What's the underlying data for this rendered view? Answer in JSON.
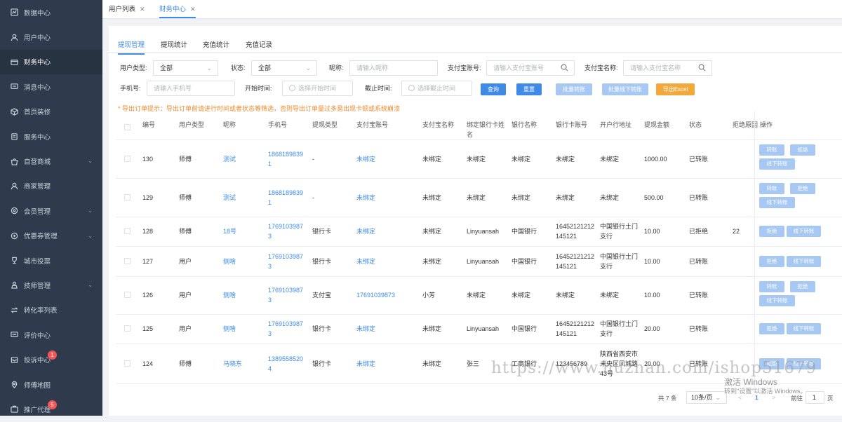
{
  "sidebar": {
    "items": [
      {
        "label": "数据中心",
        "icon": "chart-icon"
      },
      {
        "label": "用户中心",
        "icon": "user-icon"
      },
      {
        "label": "财务中心",
        "icon": "wallet-icon",
        "active": true
      },
      {
        "label": "消息中心",
        "icon": "message-icon"
      },
      {
        "label": "首页装修",
        "icon": "box-icon"
      },
      {
        "label": "服务中心",
        "icon": "clipboard-icon"
      },
      {
        "label": "自营商城",
        "icon": "shop-icon",
        "expandable": true
      },
      {
        "label": "商家管理",
        "icon": "merchant-icon"
      },
      {
        "label": "会员管理",
        "icon": "member-icon",
        "expandable": true
      },
      {
        "label": "优惠券管理",
        "icon": "coupon-icon",
        "expandable": true
      },
      {
        "label": "城市投票",
        "icon": "trophy-icon"
      },
      {
        "label": "技师管理",
        "icon": "technician-icon",
        "expandable": true
      },
      {
        "label": "转化率列表",
        "icon": "conversion-icon"
      },
      {
        "label": "评价中心",
        "icon": "comment-icon"
      },
      {
        "label": "投诉中心",
        "icon": "complaint-icon",
        "badge": "1"
      },
      {
        "label": "师傅地图",
        "icon": "map-pin-icon"
      },
      {
        "label": "推广代理",
        "icon": "promo-icon",
        "badge": "5"
      }
    ]
  },
  "page_tabs": [
    {
      "label": "用户列表",
      "active": false
    },
    {
      "label": "财务中心",
      "active": true
    }
  ],
  "inner_tabs": [
    "提现管理",
    "提现统计",
    "充值统计",
    "充值记录"
  ],
  "filters": {
    "user_type_label": "用户类型:",
    "user_type_value": "全部",
    "status_label": "状态:",
    "status_value": "全部",
    "nickname_label": "昵称:",
    "nickname_placeholder": "请输入昵称",
    "alipay_account_label": "支付宝账号:",
    "alipay_account_placeholder": "请输入支付宝账号",
    "alipay_name_label": "支付宝名称:",
    "alipay_name_placeholder": "请输入支付宝名称",
    "phone_label": "手机号:",
    "phone_placeholder": "请输入手机号",
    "start_label": "开始时间:",
    "start_placeholder": "选择开始时间",
    "end_label": "截止时间:",
    "end_placeholder": "选择截止时间"
  },
  "buttons": {
    "query": "查询",
    "reset": "重置",
    "batch_transfer": "批量转账",
    "batch_offline": "批量线下转账",
    "export": "导出Excel"
  },
  "notice": "* 导出订单提示：导出订单前请进行时间或者状态等筛选，否则导出订单量过多易出现卡顿或系统崩溃",
  "table": {
    "headers": [
      "编号",
      "用户类型",
      "昵称",
      "手机号",
      "提现类型",
      "支付宝账号",
      "支付宝名称",
      "绑定银行卡姓名",
      "银行名称",
      "银行卡账号",
      "开户行地址",
      "提现金额",
      "状态",
      "拒绝原因",
      "操作"
    ],
    "rows": [
      {
        "id": "130",
        "user_type": "师傅",
        "nickname": "测试",
        "phone": "18681898391",
        "withdraw_type": "-",
        "alipay_account": "未绑定",
        "alipay_name": "未绑定",
        "bank_holder": "未绑定",
        "bank_name": "未绑定",
        "bank_card": "未绑定",
        "bank_address": "未绑定",
        "amount": "1000.00",
        "status": "已转账",
        "reason": "",
        "actions": [
          "转账",
          "拒绝",
          "线下转账"
        ]
      },
      {
        "id": "129",
        "user_type": "师傅",
        "nickname": "测试",
        "phone": "18681898391",
        "withdraw_type": "-",
        "alipay_account": "未绑定",
        "alipay_name": "未绑定",
        "bank_holder": "未绑定",
        "bank_name": "未绑定",
        "bank_card": "未绑定",
        "bank_address": "未绑定",
        "amount": "500.00",
        "status": "已转账",
        "reason": "",
        "actions": [
          "转账",
          "拒绝",
          "线下转账"
        ]
      },
      {
        "id": "128",
        "user_type": "师傅",
        "nickname": "18号",
        "phone": "17691039873",
        "withdraw_type": "银行卡",
        "alipay_account": "未绑定",
        "alipay_name": "未绑定",
        "bank_holder": "Linyuansah",
        "bank_name": "中国银行",
        "bank_card": "16452121212145121",
        "bank_address": "中国银行土门支行",
        "amount": "10.00",
        "status": "已拒绝",
        "reason": "22",
        "actions": [
          "拒绝",
          "线下转账"
        ]
      },
      {
        "id": "127",
        "user_type": "用户",
        "nickname": "侧啥",
        "phone": "17691039873",
        "withdraw_type": "银行卡",
        "alipay_account": "未绑定",
        "alipay_name": "未绑定",
        "bank_holder": "Linyuansah",
        "bank_name": "中国银行",
        "bank_card": "16452121212145121",
        "bank_address": "中国银行土门支行",
        "amount": "10.00",
        "status": "已转账",
        "reason": "",
        "actions": [
          "拒绝",
          "线下转账"
        ]
      },
      {
        "id": "126",
        "user_type": "用户",
        "nickname": "侧啥",
        "phone": "17691039873",
        "withdraw_type": "支付宝",
        "alipay_account": "17691039873",
        "alipay_name": "小芳",
        "bank_holder": "未绑定",
        "bank_name": "未绑定",
        "bank_card": "未绑定",
        "bank_address": "未绑定",
        "amount": "10.00",
        "status": "已转账",
        "reason": "",
        "actions": [
          "转账",
          "拒绝",
          "线下转账"
        ]
      },
      {
        "id": "125",
        "user_type": "用户",
        "nickname": "侧啥",
        "phone": "17691039873",
        "withdraw_type": "银行卡",
        "alipay_account": "未绑定",
        "alipay_name": "未绑定",
        "bank_holder": "Linyuansah",
        "bank_name": "中国银行",
        "bank_card": "16452121212145121",
        "bank_address": "中国银行土门支行",
        "amount": "20.00",
        "status": "已转账",
        "reason": "",
        "actions": [
          "拒绝",
          "线下转账"
        ]
      },
      {
        "id": "124",
        "user_type": "师傅",
        "nickname": "马晓东",
        "phone": "13895585204",
        "withdraw_type": "银行卡",
        "alipay_account": "未绑定",
        "alipay_name": "未绑定",
        "bank_holder": "张三",
        "bank_name": "工商银行",
        "bank_card": "123456789",
        "bank_address": "陕西省西安市未央区凤城路43号",
        "amount": "20.00",
        "status": "已转账",
        "reason": "",
        "actions": [
          "拒绝",
          "线下转账"
        ]
      }
    ]
  },
  "pagination": {
    "total": "共 7 条",
    "page_size": "10条/页",
    "prev": "<",
    "current": "1",
    "next": ">",
    "goto_label": "前往",
    "goto_value": "1",
    "page_suffix": "页"
  },
  "watermark": "https://www.huzhan.com/ishop51679",
  "windows_activation": {
    "title": "激活 Windows",
    "sub": "转到\"设置\"以激活 Windows。"
  },
  "colors": {
    "primary": "#3f8ae6",
    "light_button": "#a6c8f3",
    "export": "#f2a93b",
    "sidebar": "#2f3b4c",
    "notice": "#f28a2c"
  }
}
